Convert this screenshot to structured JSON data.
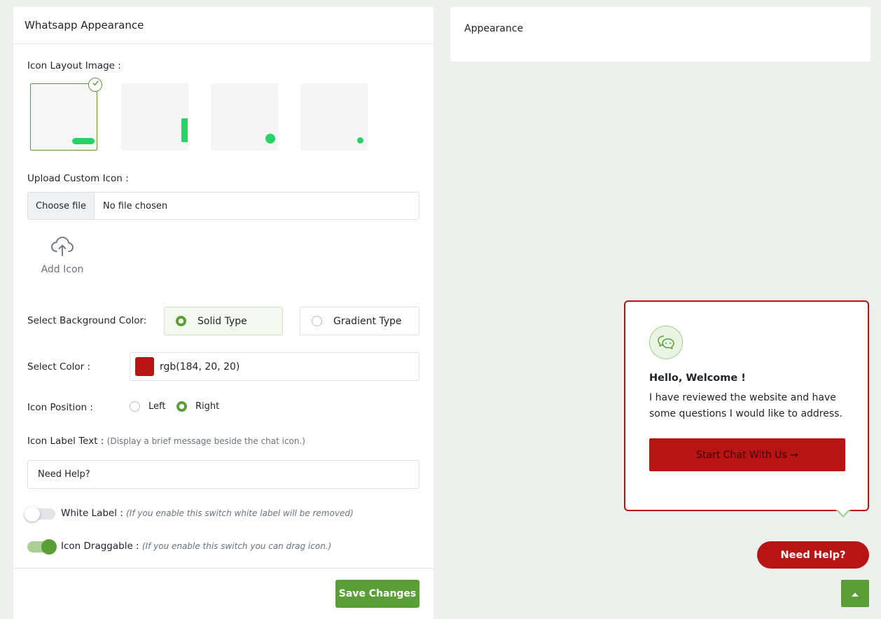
{
  "left_panel": {
    "title": "Whatsapp Appearance",
    "icon_layout_label": "Icon Layout Image :",
    "upload_label": "Upload Custom Icon :",
    "file_button": "Choose file",
    "file_status": "No file chosen",
    "add_icon_label": "Add Icon",
    "bg_color_label": "Select Background Color:",
    "bg_options": [
      "Solid Type",
      "Gradient Type"
    ],
    "bg_selected": "Solid Type",
    "select_color_label": "Select Color :",
    "color_value": "rgb(184, 20, 20)",
    "icon_position_label": "Icon Position :",
    "position_options": [
      "Left",
      "Right"
    ],
    "position_selected": "Right",
    "icon_label_text_label": "Icon Label Text :",
    "icon_label_text_hint": "(Display a brief message beside the chat icon.)",
    "icon_label_text_value": "Need Help?",
    "white_label": "White Label :",
    "white_label_hint": "(If you enable this switch white label will be removed)",
    "white_label_enabled": false,
    "draggable_label": "Icon Draggable :",
    "draggable_hint": "(If you enable this switch you can drag icon.)",
    "draggable_enabled": true,
    "save_button": "Save Changes"
  },
  "right_panel": {
    "title": "Appearance"
  },
  "preview": {
    "popup_title": "Hello, Welcome !",
    "popup_body": "I have reviewed the website and have some questions I would like to address.",
    "popup_button": "Start Chat With Us →",
    "floating_label": "Need Help?"
  },
  "colors": {
    "accent_green": "#5a9e36",
    "brand_red": "#b81414",
    "whatsapp_green": "#25d366"
  },
  "icons": [
    "check-icon",
    "cloud-upload-icon",
    "chat-bubbles-icon",
    "whatsapp-icon",
    "chevron-up-icon"
  ]
}
